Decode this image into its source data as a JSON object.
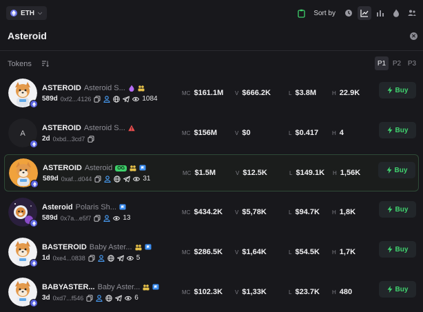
{
  "topbar": {
    "chain_label": "ETH",
    "sort_label": "Sort by",
    "sort_options": [
      "clock-icon",
      "chart-line-icon",
      "bar-chart-icon",
      "flame-icon",
      "users-icon"
    ],
    "active_sort": "chart-line-icon"
  },
  "search": {
    "query": "Asteroid"
  },
  "tokens_section": {
    "label": "Tokens",
    "presets": [
      "P1",
      "P2",
      "P3"
    ],
    "active_preset": "P1"
  },
  "stat_keys": {
    "mc": "MC",
    "v": "V",
    "l": "L",
    "h": "H"
  },
  "buy_label": "Buy",
  "tokens": [
    {
      "symbol": "ASTEROID",
      "name": "Asteroid S...",
      "badges": [
        "flame-icon",
        "people-icon"
      ],
      "age": "589d",
      "address": "0xf2...4126",
      "links": [
        "copy-icon",
        "user-icon",
        "globe-icon",
        "telegram-icon",
        "eye-icon"
      ],
      "holders": "1084",
      "mc": "$161.1M",
      "v": "$666.2K",
      "l": "$3.8M",
      "h": "22.9K",
      "avatar": "shiba-astronaut"
    },
    {
      "symbol": "ASTEROID",
      "name": "Asteroid S...",
      "badges": [
        "warning-icon"
      ],
      "age": "2d",
      "address": "0xbd...3cd7",
      "links": [
        "copy-icon"
      ],
      "holders": "",
      "mc": "$156M",
      "v": "$0",
      "l": "$0.417",
      "h": "4",
      "avatar": "letter",
      "avatar_letter": "A"
    },
    {
      "symbol": "ASTEROID",
      "name": "Asteroid",
      "og": "OG",
      "badges": [
        "people-icon",
        "flag-icon"
      ],
      "age": "589d",
      "address": "0xaf...d044",
      "links": [
        "copy-icon",
        "user-icon",
        "globe-icon",
        "telegram-icon",
        "eye-icon"
      ],
      "holders": "31",
      "mc": "$1.5M",
      "v": "$12.5K",
      "l": "$149.1K",
      "h": "1,56K",
      "avatar": "shiba-astronaut-orange"
    },
    {
      "symbol": "Asteroid",
      "name": "Polaris Sh...",
      "badges": [
        "flag-icon"
      ],
      "age": "589d",
      "address": "0x7a...e5f7",
      "links": [
        "copy-icon",
        "user-icon",
        "eye-icon"
      ],
      "holders": "13",
      "mc": "$434.2K",
      "v": "$5,78K",
      "l": "$94.7K",
      "h": "1,8K",
      "avatar": "space-shiba"
    },
    {
      "symbol": "BASTEROID",
      "name": "Baby Aster...",
      "badges": [
        "people-icon",
        "flag-icon"
      ],
      "age": "1d",
      "address": "0xe4...0838",
      "links": [
        "copy-icon",
        "user-icon",
        "globe-icon",
        "telegram-icon",
        "eye-icon"
      ],
      "holders": "5",
      "mc": "$286.5K",
      "v": "$1,64K",
      "l": "$54.5K",
      "h": "1,7K",
      "avatar": "baby-shiba"
    },
    {
      "symbol": "BABYASTER...",
      "name": "Baby Aster...",
      "badges": [
        "people-icon",
        "flag-icon"
      ],
      "age": "3d",
      "address": "0xd7...f546",
      "links": [
        "copy-icon",
        "user-icon",
        "globe-icon",
        "telegram-icon",
        "eye-icon"
      ],
      "holders": "6",
      "mc": "$102.3K",
      "v": "$1,33K",
      "l": "$23.7K",
      "h": "480",
      "avatar": "baby-shiba-2"
    }
  ],
  "colors": {
    "background": "#18181c",
    "accent_green": "#40d36f",
    "eth_blue": "#6b74e8",
    "highlight_border": "#2f4a37"
  }
}
